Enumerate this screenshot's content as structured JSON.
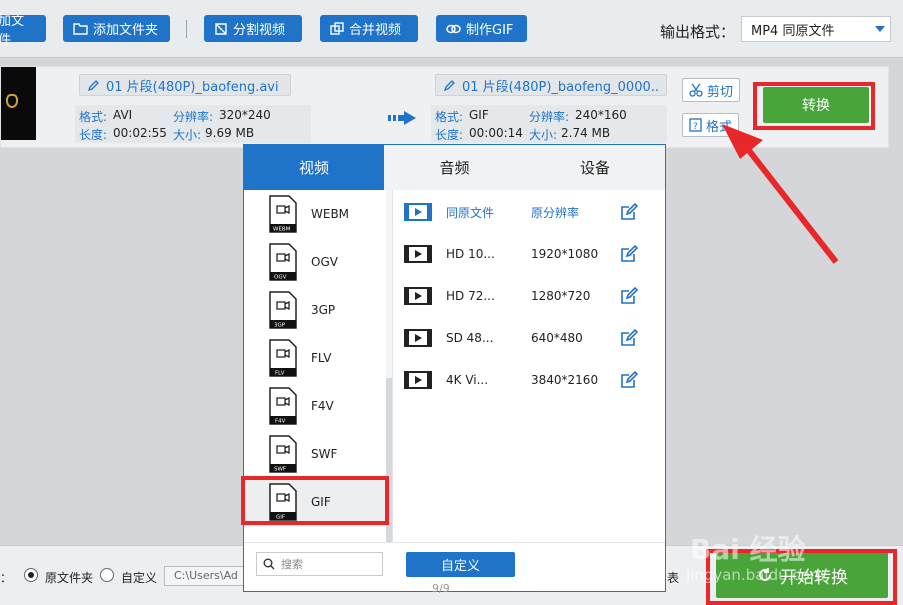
{
  "toolbar": {
    "add_file": "加文件",
    "add_folder": "添加文件夹",
    "split_video": "分割视频",
    "merge_video": "合并视频",
    "make_gif": "制作GIF",
    "output_format_label": "输出格式：",
    "output_format_value": "MP4  同原文件"
  },
  "file": {
    "source_name": "01 片段(480P)_baofeng.avi",
    "source_format_label": "格式:",
    "source_format": "AVI",
    "source_res_label": "分辨率:",
    "source_res": "320*240",
    "source_len_label": "长度:",
    "source_len": "00:02:55",
    "source_size_label": "大小:",
    "source_size": "9.69 MB",
    "output_name": "01 片段(480P)_baofeng_0000..",
    "output_format_label": "格式:",
    "output_format": "GIF",
    "output_res_label": "分辨率:",
    "output_res": "240*160",
    "output_len_label": "长度:",
    "output_len": "00:00:14",
    "output_size_label": "大小:",
    "output_size": "2.74 MB",
    "cut_label": "剪切",
    "format_label": "格式",
    "convert_label": "转换"
  },
  "popup": {
    "tabs": [
      "视频",
      "音频",
      "设备"
    ],
    "formats": [
      "WEBM",
      "OGV",
      "3GP",
      "FLV",
      "F4V",
      "SWF",
      "GIF"
    ],
    "qualities": [
      {
        "name": "同原文件",
        "res": "原分辨率"
      },
      {
        "name": "HD 10...",
        "res": "1920*1080"
      },
      {
        "name": "HD 72...",
        "res": "1280*720"
      },
      {
        "name": "SD 48...",
        "res": "640*480"
      },
      {
        "name": "4K Vi...",
        "res": "3840*2160"
      }
    ],
    "search_placeholder": "搜索",
    "custom_label": "自定义",
    "page": "9/9"
  },
  "bottom": {
    "output_dir_prefix": "：",
    "original_folder": "原文件夹",
    "custom": "自定义",
    "path": "C:\\Users\\Ad",
    "trailing": "表",
    "start_convert": "开始转换"
  },
  "watermark": {
    "brand": "Bai 经验",
    "sub": "jingyan.baidu.com"
  },
  "colors": {
    "accent": "#1f73c9",
    "green": "#49a53a",
    "highlight": "#e8272b"
  }
}
